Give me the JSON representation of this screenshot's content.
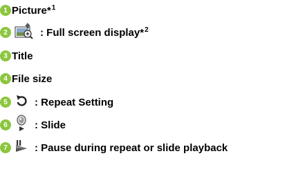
{
  "accent_color": "#8cc63e",
  "items": [
    {
      "number": "1",
      "text": "Picture*",
      "footnote": "1"
    },
    {
      "number": "2",
      "icon": "full-screen-icon",
      "text": ": Full screen display*",
      "footnote": "2"
    },
    {
      "number": "3",
      "text": "Title"
    },
    {
      "number": "4",
      "text": "File size"
    },
    {
      "number": "5",
      "icon": "repeat-icon",
      "text": ": Repeat Setting"
    },
    {
      "number": "6",
      "icon": "slide-icon",
      "text": ": Slide"
    },
    {
      "number": "7",
      "icon": "pause-play-icon",
      "text": ": Pause during repeat or slide playback"
    }
  ]
}
